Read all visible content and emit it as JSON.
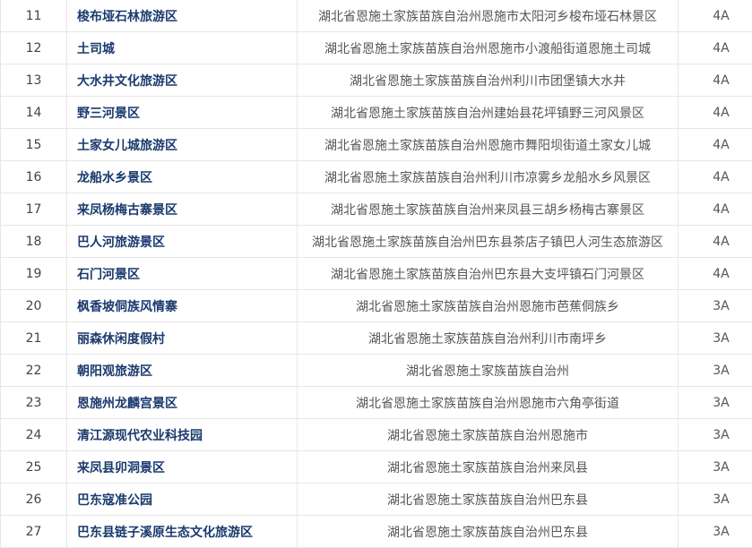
{
  "table": {
    "rows": [
      {
        "num": "11",
        "name": "梭布垭石林旅游区",
        "address": "湖北省恩施土家族苗族自治州恩施市太阳河乡梭布垭石林景区",
        "grade": "4A"
      },
      {
        "num": "12",
        "name": "土司城",
        "address": "湖北省恩施土家族苗族自治州恩施市小渡船街道恩施土司城",
        "grade": "4A"
      },
      {
        "num": "13",
        "name": "大水井文化旅游区",
        "address": "湖北省恩施土家族苗族自治州利川市团堡镇大水井",
        "grade": "4A"
      },
      {
        "num": "14",
        "name": "野三河景区",
        "address": "湖北省恩施土家族苗族自治州建始县花坪镇野三河风景区",
        "grade": "4A"
      },
      {
        "num": "15",
        "name": "土家女儿城旅游区",
        "address": "湖北省恩施土家族苗族自治州恩施市舞阳坝街道土家女儿城",
        "grade": "4A"
      },
      {
        "num": "16",
        "name": "龙船水乡景区",
        "address": "湖北省恩施土家族苗族自治州利川市凉雾乡龙船水乡风景区",
        "grade": "4A"
      },
      {
        "num": "17",
        "name": "来凤杨梅古寨景区",
        "address": "湖北省恩施土家族苗族自治州来凤县三胡乡杨梅古寨景区",
        "grade": "4A"
      },
      {
        "num": "18",
        "name": "巴人河旅游景区",
        "address": "湖北省恩施土家族苗族自治州巴东县茶店子镇巴人河生态旅游区",
        "grade": "4A"
      },
      {
        "num": "19",
        "name": "石门河景区",
        "address": "湖北省恩施土家族苗族自治州巴东县大支坪镇石门河景区",
        "grade": "4A"
      },
      {
        "num": "20",
        "name": "枫香坡侗族风情寨",
        "address": "湖北省恩施土家族苗族自治州恩施市芭蕉侗族乡",
        "grade": "3A"
      },
      {
        "num": "21",
        "name": "丽森休闲度假村",
        "address": "湖北省恩施土家族苗族自治州利川市南坪乡",
        "grade": "3A"
      },
      {
        "num": "22",
        "name": "朝阳观旅游区",
        "address": "湖北省恩施土家族苗族自治州",
        "grade": "3A"
      },
      {
        "num": "23",
        "name": "恩施州龙麟宫景区",
        "address": "湖北省恩施土家族苗族自治州恩施市六角亭街道",
        "grade": "3A"
      },
      {
        "num": "24",
        "name": "清江源现代农业科技园",
        "address": "湖北省恩施土家族苗族自治州恩施市",
        "grade": "3A"
      },
      {
        "num": "25",
        "name": "来凤县卯洞景区",
        "address": "湖北省恩施土家族苗族自治州来凤县",
        "grade": "3A"
      },
      {
        "num": "26",
        "name": "巴东寇准公园",
        "address": "湖北省恩施土家族苗族自治州巴东县",
        "grade": "3A"
      },
      {
        "num": "27",
        "name": "巴东县链子溪原生态文化旅游区",
        "address": "湖北省恩施土家族苗族自治州巴东县",
        "grade": "3A"
      }
    ]
  }
}
